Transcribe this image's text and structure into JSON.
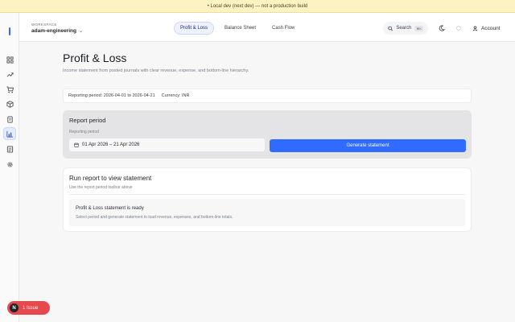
{
  "banner": {
    "text": "• Local dev (next dev) — not a production build"
  },
  "workspace": {
    "label": "WORKSPACE",
    "name": "adam-engineering"
  },
  "tabs": [
    {
      "label": "Profit & Loss",
      "active": true
    },
    {
      "label": "Balance Sheet",
      "active": false
    },
    {
      "label": "Cash Flow",
      "active": false
    }
  ],
  "search": {
    "label": "Search",
    "shortcut": "⌘K"
  },
  "account": {
    "label": "Account"
  },
  "page": {
    "title": "Profit & Loss",
    "subtitle": "Income statement from posted journals with clear revenue, expense, and bottom-line hierarchy."
  },
  "info": {
    "reporting_period": "Reporting period: 2026-04-01 to 2026-04-21",
    "currency": "Currency: INR"
  },
  "report_period": {
    "title": "Report period",
    "field_label": "Reporting period",
    "date_range": "01 Apr 2026 – 21 Apr 2026",
    "generate_label": "Generate statement"
  },
  "result": {
    "title": "Run report to view statement",
    "subtitle": "Use the report period toolbar above",
    "empty_title": "Profit & Loss statement is ready",
    "empty_body": "Select period and generate statement to load revenue, expenses, and bottom-line totals."
  },
  "issues": {
    "badge": "N",
    "label": "1 Issue"
  },
  "sidebar": {
    "items": [
      {
        "icon": "grid-icon"
      },
      {
        "icon": "trend-icon"
      },
      {
        "icon": "cart-icon"
      },
      {
        "icon": "box-icon"
      },
      {
        "icon": "document-icon"
      },
      {
        "icon": "bar-chart-icon",
        "active": true
      },
      {
        "icon": "ledger-icon"
      },
      {
        "icon": "gear-icon"
      }
    ]
  },
  "colors": {
    "accent": "#2f6bff",
    "banner": "#fdf3c2",
    "issue": "#e5484d"
  }
}
